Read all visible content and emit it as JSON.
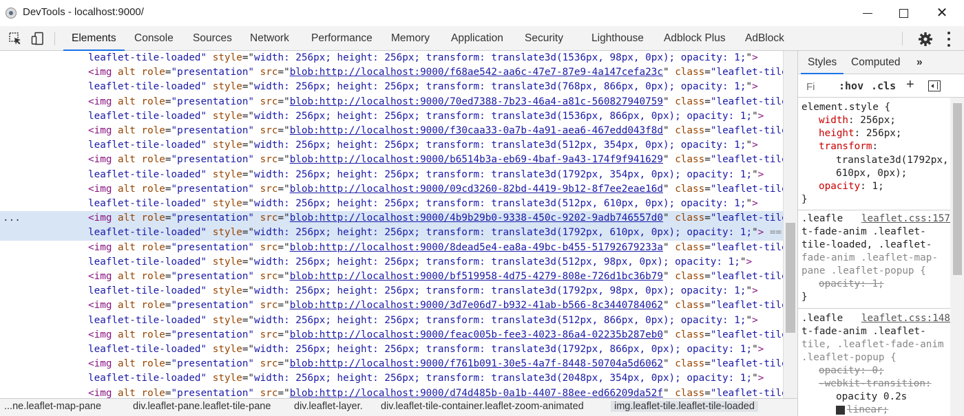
{
  "window": {
    "title": "DevTools - localhost:9000/"
  },
  "toolbar": {
    "tabs": [
      "Elements",
      "Console",
      "Sources",
      "Network",
      "Performance",
      "Memory",
      "Application",
      "Security",
      "Lighthouse",
      "Adblock Plus",
      "AdBlock"
    ],
    "active_tab": "Elements"
  },
  "dom": {
    "lines": [
      {
        "kind": "cont",
        "style": "width: 256px; height: 256px; transform: translate3d(1536px, 98px, 0px); opacity: 1;"
      },
      {
        "kind": "img",
        "src": "blob:http://localhost:9000/f68ae542-aa6c-47e7-87e9-4a147cefa23c"
      },
      {
        "kind": "cont",
        "style": "width: 256px; height: 256px; transform: translate3d(768px, 866px, 0px); opacity: 1;"
      },
      {
        "kind": "img",
        "src": "blob:http://localhost:9000/70ed7388-7b23-46a4-a81c-560827940759"
      },
      {
        "kind": "cont",
        "style": "width: 256px; height: 256px; transform: translate3d(1536px, 866px, 0px); opacity: 1;"
      },
      {
        "kind": "img",
        "src": "blob:http://localhost:9000/f30caa33-0a7b-4a91-aea6-467edd043f8d"
      },
      {
        "kind": "cont",
        "style": "width: 256px; height: 256px; transform: translate3d(512px, 354px, 0px); opacity: 1;"
      },
      {
        "kind": "img",
        "src": "blob:http://localhost:9000/b6514b3a-eb69-4baf-9a43-174f9f941629"
      },
      {
        "kind": "cont",
        "style": "width: 256px; height: 256px; transform: translate3d(1792px, 354px, 0px); opacity: 1;"
      },
      {
        "kind": "img",
        "src": "blob:http://localhost:9000/09cd3260-82bd-4419-9b12-8f7ee2eae16d"
      },
      {
        "kind": "cont",
        "style": "width: 256px; height: 256px; transform: translate3d(512px, 610px, 0px); opacity: 1;"
      },
      {
        "kind": "img",
        "src": "blob:http://localhost:9000/4b9b29b0-9338-450c-9202-9adb746557d0",
        "selected": true
      },
      {
        "kind": "cont",
        "style": "width: 256px; height: 256px; transform: translate3d(1792px, 610px, 0px); opacity: 1;",
        "selected": true,
        "suffix": "== $0"
      },
      {
        "kind": "img",
        "src": "blob:http://localhost:9000/8dead5e4-ea8a-49bc-b455-51792679233a"
      },
      {
        "kind": "cont",
        "style": "width: 256px; height: 256px; transform: translate3d(512px, 98px, 0px); opacity: 1;"
      },
      {
        "kind": "img",
        "src": "blob:http://localhost:9000/bf519958-4d75-4279-808e-726d1bc36b79"
      },
      {
        "kind": "cont",
        "style": "width: 256px; height: 256px; transform: translate3d(1792px, 98px, 0px); opacity: 1;"
      },
      {
        "kind": "img",
        "src": "blob:http://localhost:9000/3d7e06d7-b932-41ab-b566-8c3440784062"
      },
      {
        "kind": "cont",
        "style": "width: 256px; height: 256px; transform: translate3d(512px, 866px, 0px); opacity: 1;"
      },
      {
        "kind": "img",
        "src": "blob:http://localhost:9000/feac005b-fee3-4023-86a4-02235b287eb0"
      },
      {
        "kind": "cont",
        "style": "width: 256px; height: 256px; transform: translate3d(1792px, 866px, 0px); opacity: 1;"
      },
      {
        "kind": "img",
        "src": "blob:http://localhost:9000/f761b091-30e5-4a7f-8448-50704a5d6062"
      },
      {
        "kind": "cont",
        "style": "width: 256px; height: 256px; transform: translate3d(2048px, 354px, 0px); opacity: 1;"
      },
      {
        "kind": "img",
        "src": "blob:http://localhost:9000/d74d485b-0a1b-4407-88ee-ed66209da52f"
      }
    ],
    "img_open": "<img",
    "attr_alt": "alt",
    "attr_role": "role",
    "role_value": "\"presentation\"",
    "attr_src": "src",
    "attr_class": "class",
    "class_value_open": "\"leaflet-tile",
    "class_value_close": "leaflet-tile-loaded\"",
    "attr_style": "style",
    "tag_close": ">",
    "selected_ellipsis": "..."
  },
  "breadcrumb": [
    "...ne.leaflet-map-pane",
    "div.leaflet-pane.leaflet-tile-pane",
    "div.leaflet-layer.",
    "div.leaflet-tile-container.leaflet-zoom-animated",
    "img.leaflet-tile.leaflet-tile-loaded"
  ],
  "styles": {
    "tabs": [
      "Styles",
      "Computed"
    ],
    "more": "»",
    "filter_placeholder": "Fi",
    "hov": ":hov",
    "cls": ".cls",
    "plus": "+",
    "element_style": {
      "selector": "element.style {",
      "props": [
        {
          "name": "width",
          "value": "256px;"
        },
        {
          "name": "height",
          "value": "256px;"
        },
        {
          "name": "transform",
          "value": ""
        }
      ],
      "transform_value_1": "translate3d(1792px,",
      "transform_value_2": "610px, 0px);",
      "opacity_name": "opacity",
      "opacity_value": "1;",
      "close": "}"
    },
    "rule1": {
      "source": "leaflet.css:157",
      "selector_lines": [
        ".leafle",
        "t-fade-anim .leaflet-",
        "tile-loaded, .leaflet-",
        "fade-anim .leaflet-map-",
        "pane .leaflet-popup {"
      ],
      "prop": "opacity: 1;",
      "close": "}"
    },
    "rule2": {
      "source": "leaflet.css:148",
      "selector_lines": [
        ".leafle",
        "t-fade-anim .leaflet-",
        "tile, .leaflet-fade-anim",
        ".leaflet-popup {"
      ],
      "prop1": "opacity: 0;",
      "prop2": "-webkit-transition:",
      "prop2_val": "opacity 0.2s",
      "prop3": "linear;"
    }
  }
}
